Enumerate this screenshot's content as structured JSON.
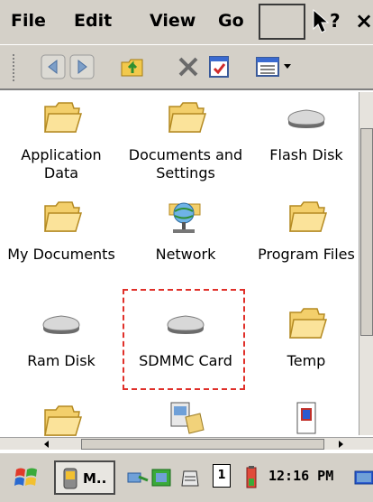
{
  "menubar": {
    "items": [
      {
        "label": "File"
      },
      {
        "label": "Edit"
      },
      {
        "label": "View"
      },
      {
        "label": "Go"
      }
    ],
    "help_icon": "help-arrow-icon",
    "close_label": "×"
  },
  "toolbar": {
    "buttons": [
      {
        "icon": "back-arrow-icon"
      },
      {
        "icon": "forward-arrow-icon"
      },
      {
        "icon": "up-folder-icon"
      },
      {
        "icon": "delete-x-icon"
      },
      {
        "icon": "properties-icon"
      },
      {
        "icon": "views-menu-icon"
      }
    ]
  },
  "files": [
    {
      "label": "Application Data",
      "icon": "folder-icon"
    },
    {
      "label": "Documents and Settings",
      "icon": "folder-icon"
    },
    {
      "label": "Flash Disk",
      "icon": "drive-icon"
    },
    {
      "label": "My Documents",
      "icon": "folder-icon"
    },
    {
      "label": "Network",
      "icon": "network-icon"
    },
    {
      "label": "Program Files",
      "icon": "folder-icon"
    },
    {
      "label": "Ram Disk",
      "icon": "drive-icon"
    },
    {
      "label": "SDMMC Card",
      "icon": "drive-icon"
    },
    {
      "label": "Temp",
      "icon": "folder-icon"
    },
    {
      "label": "",
      "icon": "folder-icon"
    },
    {
      "label": "",
      "icon": "control-panel-icon"
    },
    {
      "label": "",
      "icon": "media-icon"
    }
  ],
  "highlight_color": "#e0302a",
  "taskbar": {
    "start_icon": "windows-flag-icon",
    "app_label": "M..",
    "keyboard_indicator": "1",
    "clock": "12:16 PM"
  }
}
